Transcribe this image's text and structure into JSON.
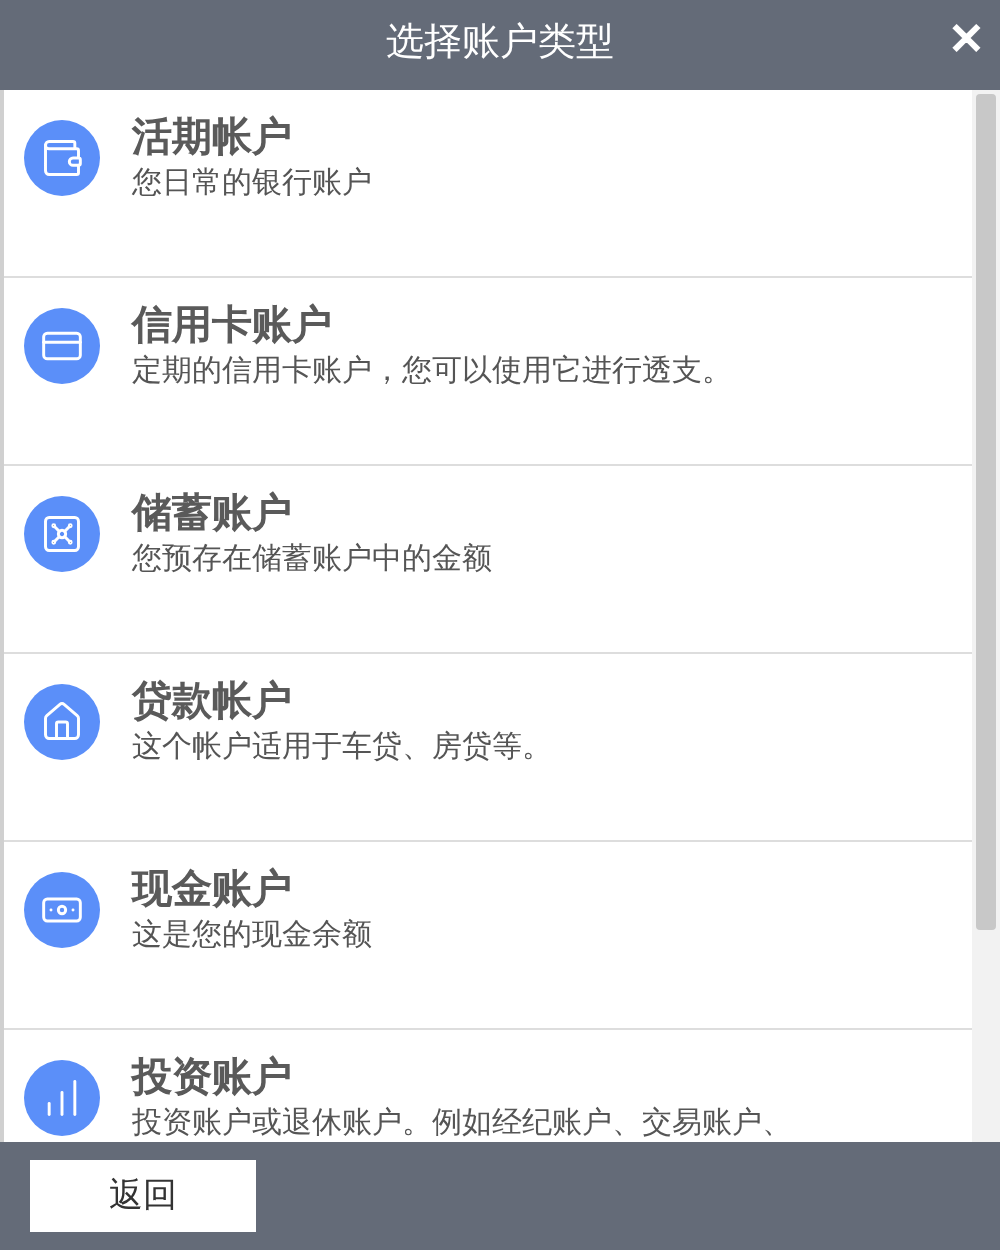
{
  "window": {
    "title": "选择账户类型",
    "close": "✕"
  },
  "accounts": [
    {
      "kind": "wallet",
      "name": "活期帐户",
      "description": "您日常的银行账户"
    },
    {
      "kind": "card",
      "name": "信用卡账户",
      "description": "定期的信用卡账户，您可以使用它进行透支。"
    },
    {
      "kind": "safe",
      "name": "储蓄账户",
      "description": "您预存在储蓄账户中的金额"
    },
    {
      "kind": "house",
      "name": "贷款帐户",
      "description": "这个帐户适用于车贷、房贷等。"
    },
    {
      "kind": "cash",
      "name": "现金账户",
      "description": "这是您的现金余额"
    },
    {
      "kind": "chart",
      "name": "投资账户",
      "description": "投资账户或退休账户。例如经纪账户、交易账户、"
    }
  ],
  "footer": {
    "back_button": "返回"
  }
}
